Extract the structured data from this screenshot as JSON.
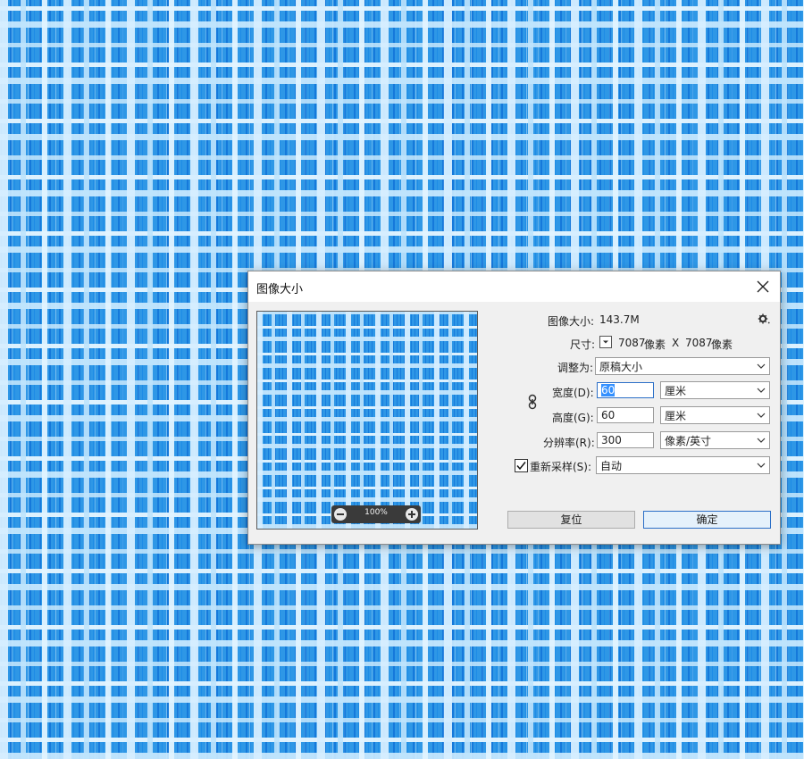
{
  "dialog": {
    "title": "图像大小",
    "image_size_label": "图像大小:",
    "image_size_value": "143.7M",
    "dimensions_label": "尺寸:",
    "dimensions_width": "7087",
    "dimensions_unit": "像素",
    "dimensions_separator": "X",
    "dimensions_height": "7087",
    "dimensions_unit2": "像素",
    "fit_to_label": "调整为:",
    "fit_to_value": "原稿大小",
    "width_label": "宽度(D):",
    "width_value": "60",
    "width_unit": "厘米",
    "height_label": "高度(G):",
    "height_value": "60",
    "height_unit": "厘米",
    "resolution_label": "分辨率(R):",
    "resolution_value": "300",
    "resolution_unit": "像素/英寸",
    "resample_label": "重新采样(S):",
    "resample_checked": true,
    "resample_value": "自动",
    "preview_zoom": "100%",
    "reset_button": "复位",
    "ok_button": "确定"
  },
  "icons": [
    "close-icon",
    "gear-icon",
    "chevron-down-icon",
    "link-chain-icon",
    "zoom-out-icon",
    "zoom-in-icon",
    "checkmark-icon"
  ],
  "colors": {
    "canvas_blue": "#2e97e6",
    "canvas_light": "#d6eeff",
    "focus_blue": "#2b6fc7",
    "dialog_bg": "#f0f0f0"
  }
}
